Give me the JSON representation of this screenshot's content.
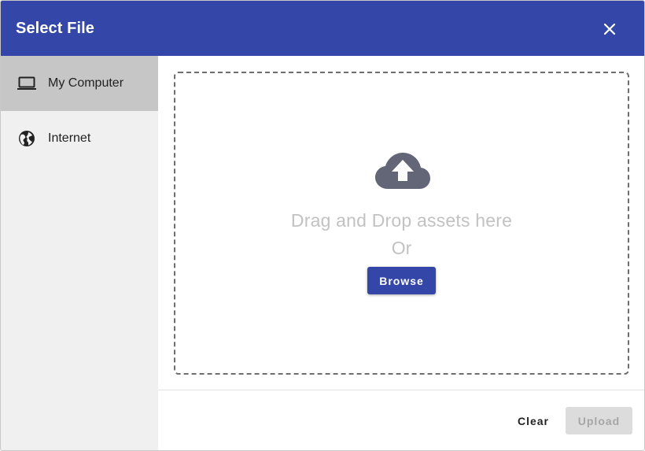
{
  "dialog": {
    "title": "Select File",
    "close_icon": "close-icon",
    "header_color": "#3447a8"
  },
  "sidebar": {
    "items": [
      {
        "label": "My Computer",
        "icon": "laptop-icon",
        "active": true
      },
      {
        "label": "Internet",
        "icon": "globe-icon",
        "active": false
      }
    ]
  },
  "dropzone": {
    "icon": "cloud-upload-icon",
    "primary_text": "Drag and Drop assets here",
    "or_text": "Or",
    "browse_label": "Browse"
  },
  "footer": {
    "clear_label": "Clear",
    "upload_label": "Upload",
    "upload_disabled": true
  }
}
